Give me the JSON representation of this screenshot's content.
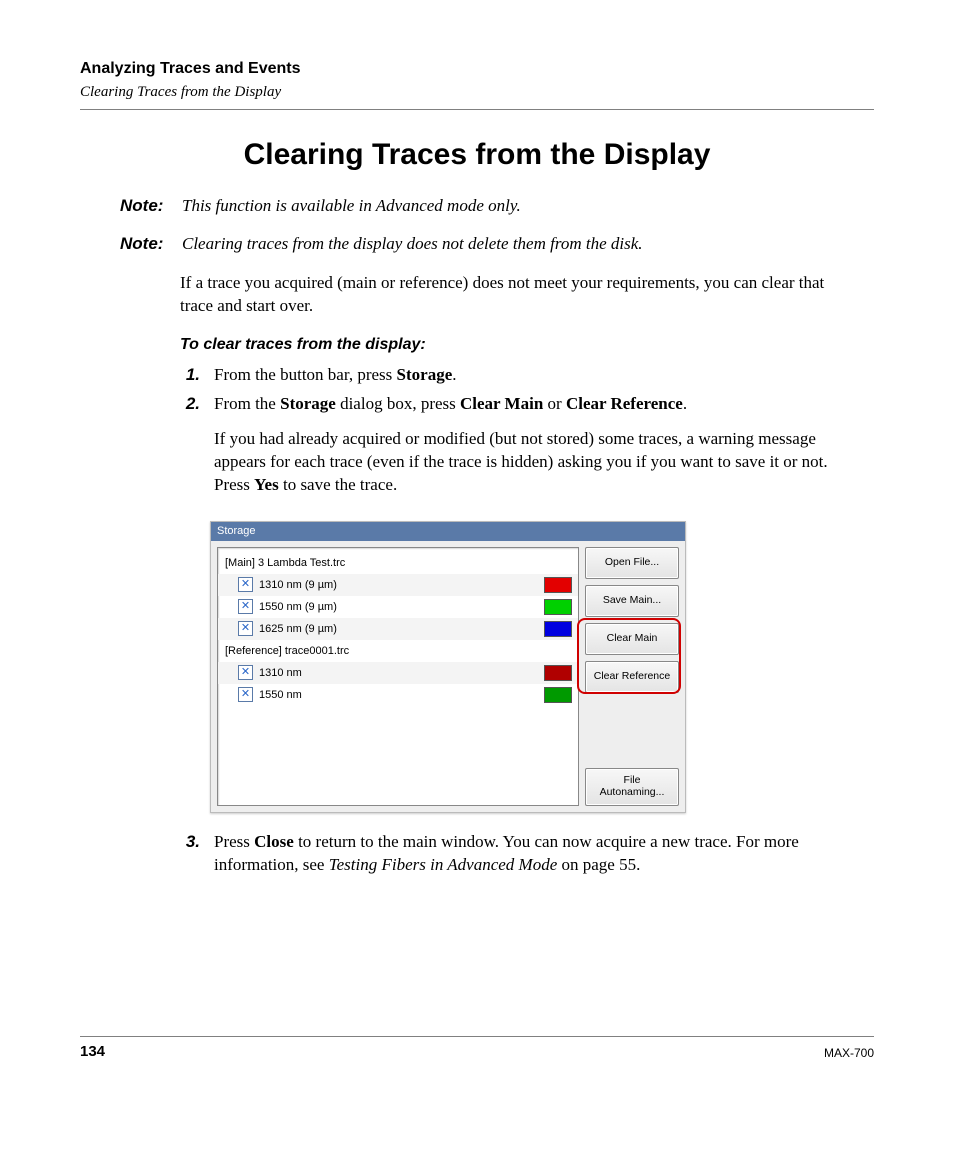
{
  "header": {
    "chapter": "Analyzing Traces and Events",
    "section": "Clearing Traces from the Display"
  },
  "title": "Clearing Traces from the Display",
  "notes": [
    {
      "label": "Note:",
      "text": "This function is available in Advanced mode only."
    },
    {
      "label": "Note:",
      "text": "Clearing traces from the display does not delete them from the disk."
    }
  ],
  "intro": "If a trace you acquired (main or reference) does not meet your requirements, you can clear that trace and start over.",
  "procedure_heading": "To clear traces from the display:",
  "steps": {
    "s1": {
      "num": "1.",
      "pre": "From the button bar, press ",
      "b1": "Storage",
      "post": "."
    },
    "s2": {
      "num": "2.",
      "pre": "From the ",
      "b1": "Storage",
      "mid": " dialog box, press ",
      "b2": "Clear Main",
      "or": " or ",
      "b3": "Clear Reference",
      "post": "."
    },
    "s2_para": {
      "pre": "If you had already acquired or modified (but not stored) some traces, a warning message appears for each trace (even if the trace is hidden) asking you if you want to save it or not. Press ",
      "b1": "Yes",
      "post": " to save the trace."
    },
    "s3": {
      "num": "3.",
      "pre": "Press ",
      "b1": "Close",
      "mid": " to return to the main window. You can now acquire a new trace. For more information, see ",
      "i1": "Testing Fibers in Advanced Mode",
      "post": " on page 55."
    }
  },
  "dialog": {
    "title": "Storage",
    "groups": [
      {
        "label": "[Main] 3 Lambda Test.trc",
        "items": [
          {
            "label": "1310 nm (9 µm)",
            "swatch": "sw-red"
          },
          {
            "label": "1550 nm (9 µm)",
            "swatch": "sw-green"
          },
          {
            "label": "1625 nm (9 µm)",
            "swatch": "sw-blue"
          }
        ]
      },
      {
        "label": "[Reference] trace0001.trc",
        "items": [
          {
            "label": "1310 nm",
            "swatch": "sw-dred"
          },
          {
            "label": "1550 nm",
            "swatch": "sw-dgreen"
          }
        ]
      }
    ],
    "buttons": {
      "open": "Open File...",
      "save": "Save Main...",
      "clear_main": "Clear Main",
      "clear_ref": "Clear Reference",
      "autonaming": "File\nAutonaming..."
    }
  },
  "footer": {
    "page": "134",
    "model": "MAX-700"
  }
}
